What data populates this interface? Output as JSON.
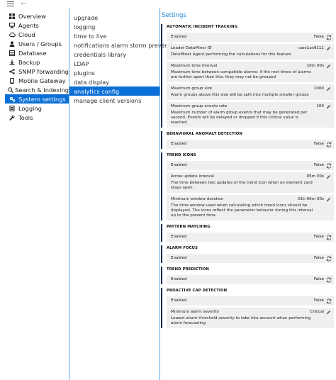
{
  "nav": {
    "items": [
      {
        "label": "Overview",
        "icon": "grid-icon"
      },
      {
        "label": "Agents",
        "icon": "agents-icon"
      },
      {
        "label": "Cloud",
        "icon": "cloud-icon"
      },
      {
        "label": "Users / Groups",
        "icon": "users-icon"
      },
      {
        "label": "Database",
        "icon": "database-icon"
      },
      {
        "label": "Backup",
        "icon": "backup-icon"
      },
      {
        "label": "SNMP forwarding",
        "icon": "snmp-icon"
      },
      {
        "label": "Mobile Gateway",
        "icon": "mobile-icon"
      },
      {
        "label": "Search & Indexing",
        "icon": "search-icon"
      },
      {
        "label": "System settings",
        "icon": "gears-icon"
      },
      {
        "label": "Logging",
        "icon": "logging-icon"
      },
      {
        "label": "Tools",
        "icon": "wrench-icon"
      }
    ],
    "selected_index": 9
  },
  "subnav": {
    "items": [
      "upgrade",
      "logging",
      "time to live",
      "notifications alarm storm prevention",
      "credentials library",
      "LDAP",
      "plugins",
      "data display",
      "analytics config",
      "manage client versions"
    ],
    "selected_index": 8
  },
  "settings": {
    "title": "Settings",
    "sections": [
      {
        "title": "AUTOMATIC INCIDENT TRACKING",
        "rows": [
          {
            "name": "Enabled",
            "value": "False",
            "action": "toggle"
          },
          {
            "name": "Leader DataMiner ID",
            "desc": "DataMiner Agent performing the calculations for this feature",
            "value": "carz1as9111",
            "action": "edit"
          },
          {
            "name": "Maximum time interval",
            "desc": "Maximum time between compatible alarms: if the root times of alarms are further apart than this, they may not be grouped",
            "value": "10m 00s",
            "action": "edit"
          },
          {
            "name": "Maximum group size",
            "desc": "Alarm groups above this size will be split into multiple smaller groups",
            "value": "1000",
            "action": "edit"
          },
          {
            "name": "Maximum group events rate",
            "desc": "Maximum number of alarm group events that may be generated per second. Events will be delayed or dropped if this critical value is reached",
            "value": "100",
            "action": "edit"
          }
        ]
      },
      {
        "title": "BEHAVIORAL ANOMALY DETECTION",
        "rows": [
          {
            "name": "Enabled",
            "value": "False",
            "action": "toggle"
          }
        ]
      },
      {
        "title": "TREND ICONS",
        "rows": [
          {
            "name": "Enabled",
            "value": "False",
            "action": "toggle"
          },
          {
            "name": "Arrow update interval",
            "desc": "The time between two updates of the trend icon when an element card stays open.",
            "value": "05m 00s",
            "action": "edit"
          },
          {
            "name": "Minimum window duration",
            "desc": "The time window used when calculating which trend icons should be displayed. The icons reflect the parameter behavior during this interval up to the present time.",
            "value": "01h 00m 00s",
            "action": "edit"
          }
        ]
      },
      {
        "title": "PATTERN MATCHING",
        "rows": [
          {
            "name": "Enabled",
            "value": "False",
            "action": "toggle"
          }
        ]
      },
      {
        "title": "ALARM FOCUS",
        "rows": [
          {
            "name": "Enabled",
            "value": "False",
            "action": "toggle"
          }
        ]
      },
      {
        "title": "TREND PREDICTION",
        "rows": [
          {
            "name": "Enabled",
            "value": "False",
            "action": "toggle"
          }
        ]
      },
      {
        "title": "PROACTIVE CAP DETECTION",
        "rows": [
          {
            "name": "Enabled",
            "value": "False",
            "action": "toggle"
          },
          {
            "name": "Minimum alarm severity",
            "desc": "Lowest alarm threshold severity to take into account when performing alarm forecasting",
            "value": "Critical",
            "action": "edit"
          }
        ]
      }
    ]
  }
}
